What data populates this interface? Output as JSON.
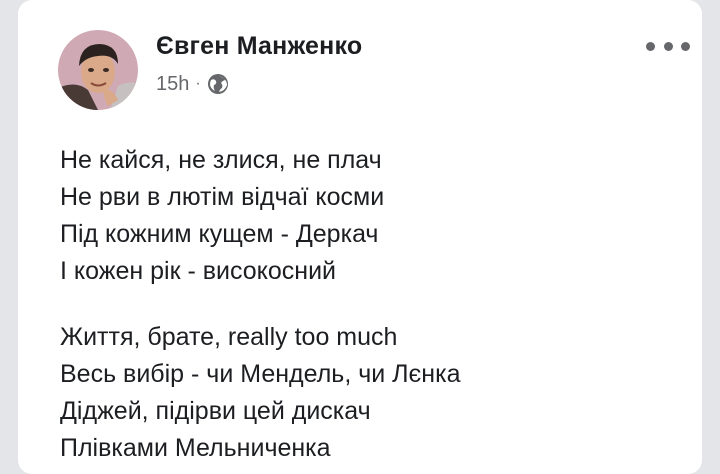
{
  "post": {
    "author_name": "Євген Манженко",
    "timestamp": "15h",
    "separator": "·",
    "privacy_icon": "globe-icon",
    "more_icon": "more-options-icon",
    "stanza1": [
      "Не кайся, не злися, не плач",
      "Не рви в лютім відчаї косми",
      "Під кожним кущем - Деркач",
      "І кожен рік - високосний"
    ],
    "stanza2": [
      "Життя, брате, really too much",
      "Весь вибір - чи Мендель, чи Лєнка",
      "Діджей, підірви цей дискач",
      "Плівками Мельниченка"
    ]
  },
  "colors": {
    "background": "#e4e5e8",
    "card": "#ffffff",
    "text": "#1c1e21",
    "secondary_text": "#65676b"
  }
}
